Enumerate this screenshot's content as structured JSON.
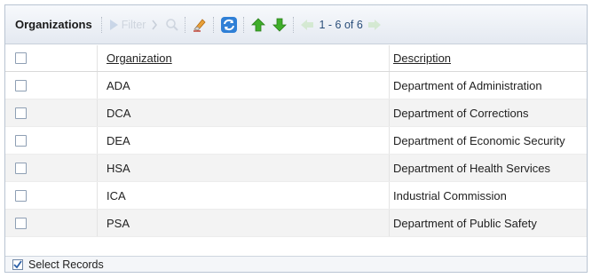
{
  "toolbar": {
    "title": "Organizations",
    "filter_label": "Filter",
    "paging_text": "1 - 6 of 6",
    "icons": [
      "filter-play-icon",
      "chevron-right-icon",
      "search-icon",
      "eraser-icon",
      "refresh-icon",
      "move-up-icon",
      "move-down-icon",
      "prev-page-icon",
      "next-page-icon"
    ]
  },
  "grid": {
    "columns": {
      "organization": "Organization",
      "description": "Description"
    },
    "rows": [
      {
        "organization": "ADA",
        "description": "Department of Administration"
      },
      {
        "organization": "DCA",
        "description": "Department of Corrections"
      },
      {
        "organization": "DEA",
        "description": "Department of Economic Security"
      },
      {
        "organization": "HSA",
        "description": "Department of Health Services"
      },
      {
        "organization": "ICA",
        "description": "Industrial Commission"
      },
      {
        "organization": "PSA",
        "description": "Department of Public Safety"
      }
    ]
  },
  "footer": {
    "select_label": "Select Records",
    "select_checked": true
  },
  "colors": {
    "arrow_green": "#3fae2a",
    "refresh_blue": "#2f7fd6",
    "paging_text": "#2a4e7a"
  }
}
